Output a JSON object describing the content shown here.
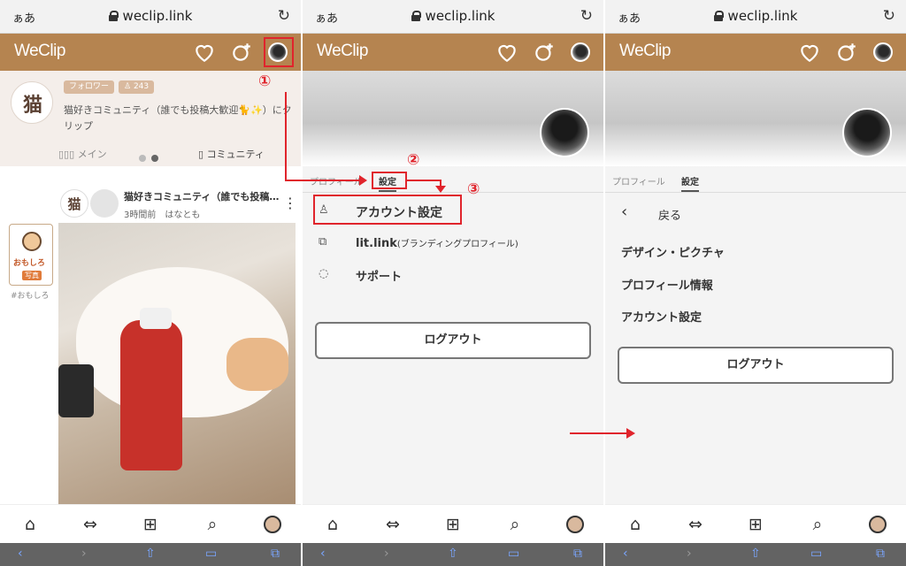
{
  "browser": {
    "aa": "ぁあ",
    "url": "weclip.link"
  },
  "app": {
    "logo": "WeClip"
  },
  "panel1": {
    "community": {
      "badge": "猫",
      "tag_follow": "フォロワー",
      "tag_count": "243",
      "description": "猫好きコミュニティ（誰でも投稿大歓迎🐈✨）にクリップ",
      "tab_main": "メイン",
      "tab_community": "コミュニティ"
    },
    "side_tag": {
      "line1": "おもしろ",
      "line2": "写真",
      "caption": "#おもしろ"
    },
    "post": {
      "avatar": "猫",
      "title": "猫好きコミュニティ（誰でも投稿…",
      "meta": "3時間前　はなとも"
    }
  },
  "panel2": {
    "tabs": [
      "プロフィール",
      "設定"
    ],
    "menu": [
      {
        "label": "アカウント設定",
        "icon": "person-icon"
      },
      {
        "label": "lit.link",
        "sub": "(ブランディングプロフィール)",
        "icon": "link-icon"
      },
      {
        "label": "サポート",
        "icon": "chat-icon"
      }
    ],
    "logout": "ログアウト"
  },
  "panel3": {
    "tabs": [
      "プロフィール",
      "設定"
    ],
    "back": "戻る",
    "menu": [
      "デザイン・ピクチャ",
      "プロフィール情報",
      "アカウント設定"
    ],
    "logout": "ログアウト"
  },
  "annotations": {
    "step1": "①",
    "step2": "②",
    "step3": "③"
  },
  "colors": {
    "header": "#b58450",
    "annotation": "#e0242c"
  }
}
